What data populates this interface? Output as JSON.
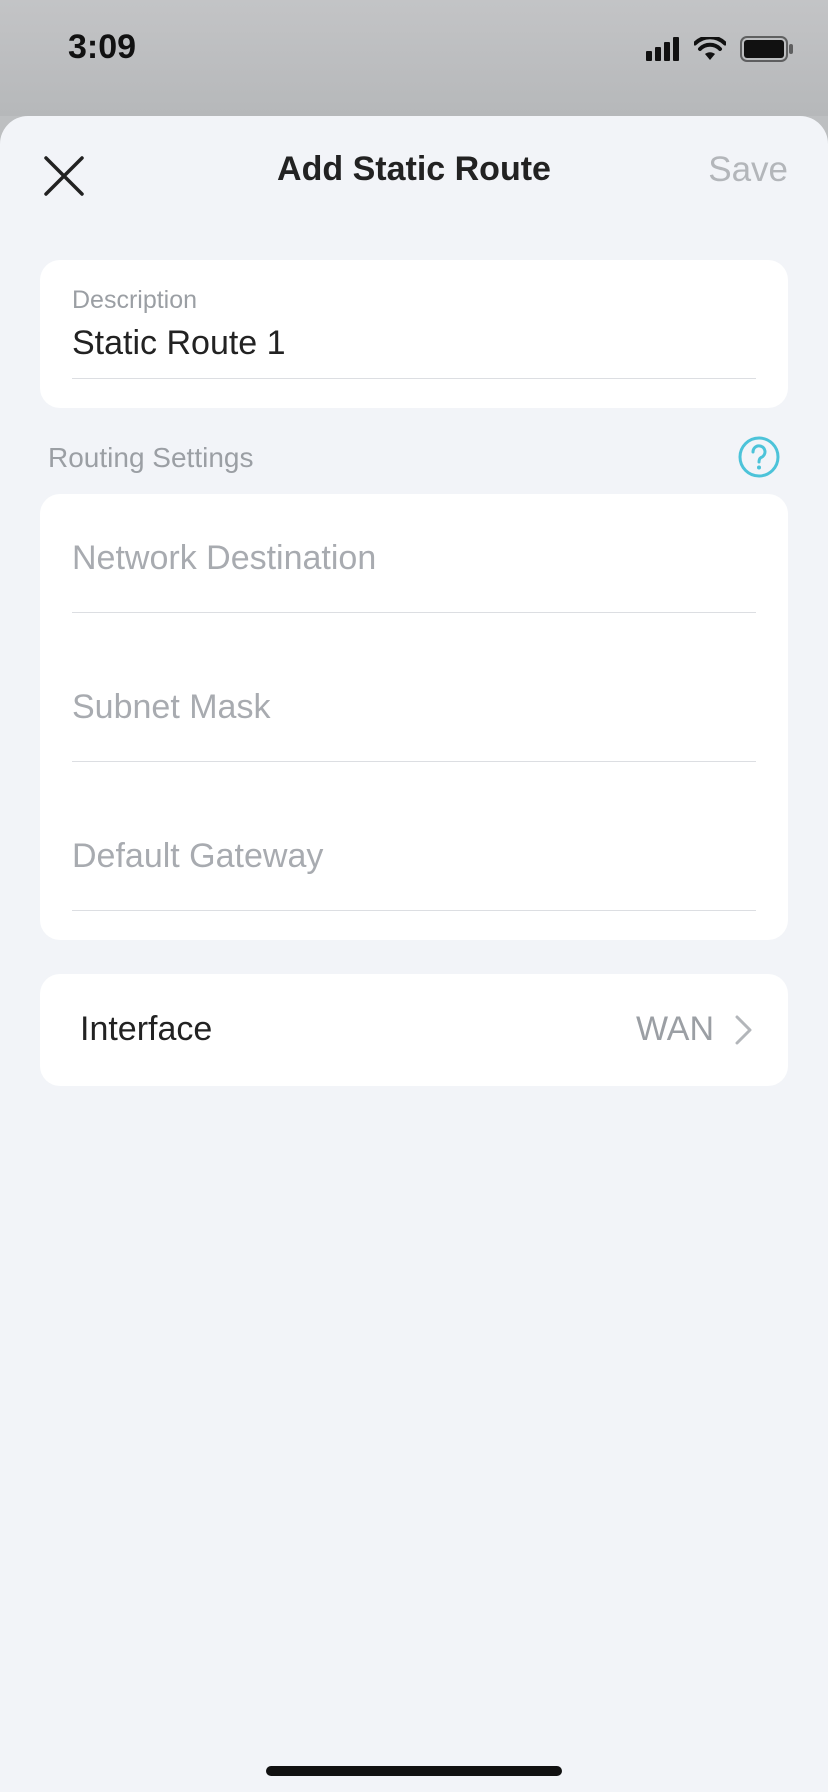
{
  "status_bar": {
    "time": "3:09"
  },
  "nav": {
    "title": "Add Static Route",
    "save_label": "Save"
  },
  "description": {
    "label": "Description",
    "value": "Static Route 1"
  },
  "routing": {
    "section_label": "Routing Settings",
    "network_destination_placeholder": "Network Destination",
    "subnet_mask_placeholder": "Subnet Mask",
    "default_gateway_placeholder": "Default Gateway"
  },
  "interface": {
    "label": "Interface",
    "value": "WAN"
  },
  "colors": {
    "accent": "#4cc3d9",
    "background": "#f2f4f8",
    "muted_text": "#9b9fa4"
  }
}
